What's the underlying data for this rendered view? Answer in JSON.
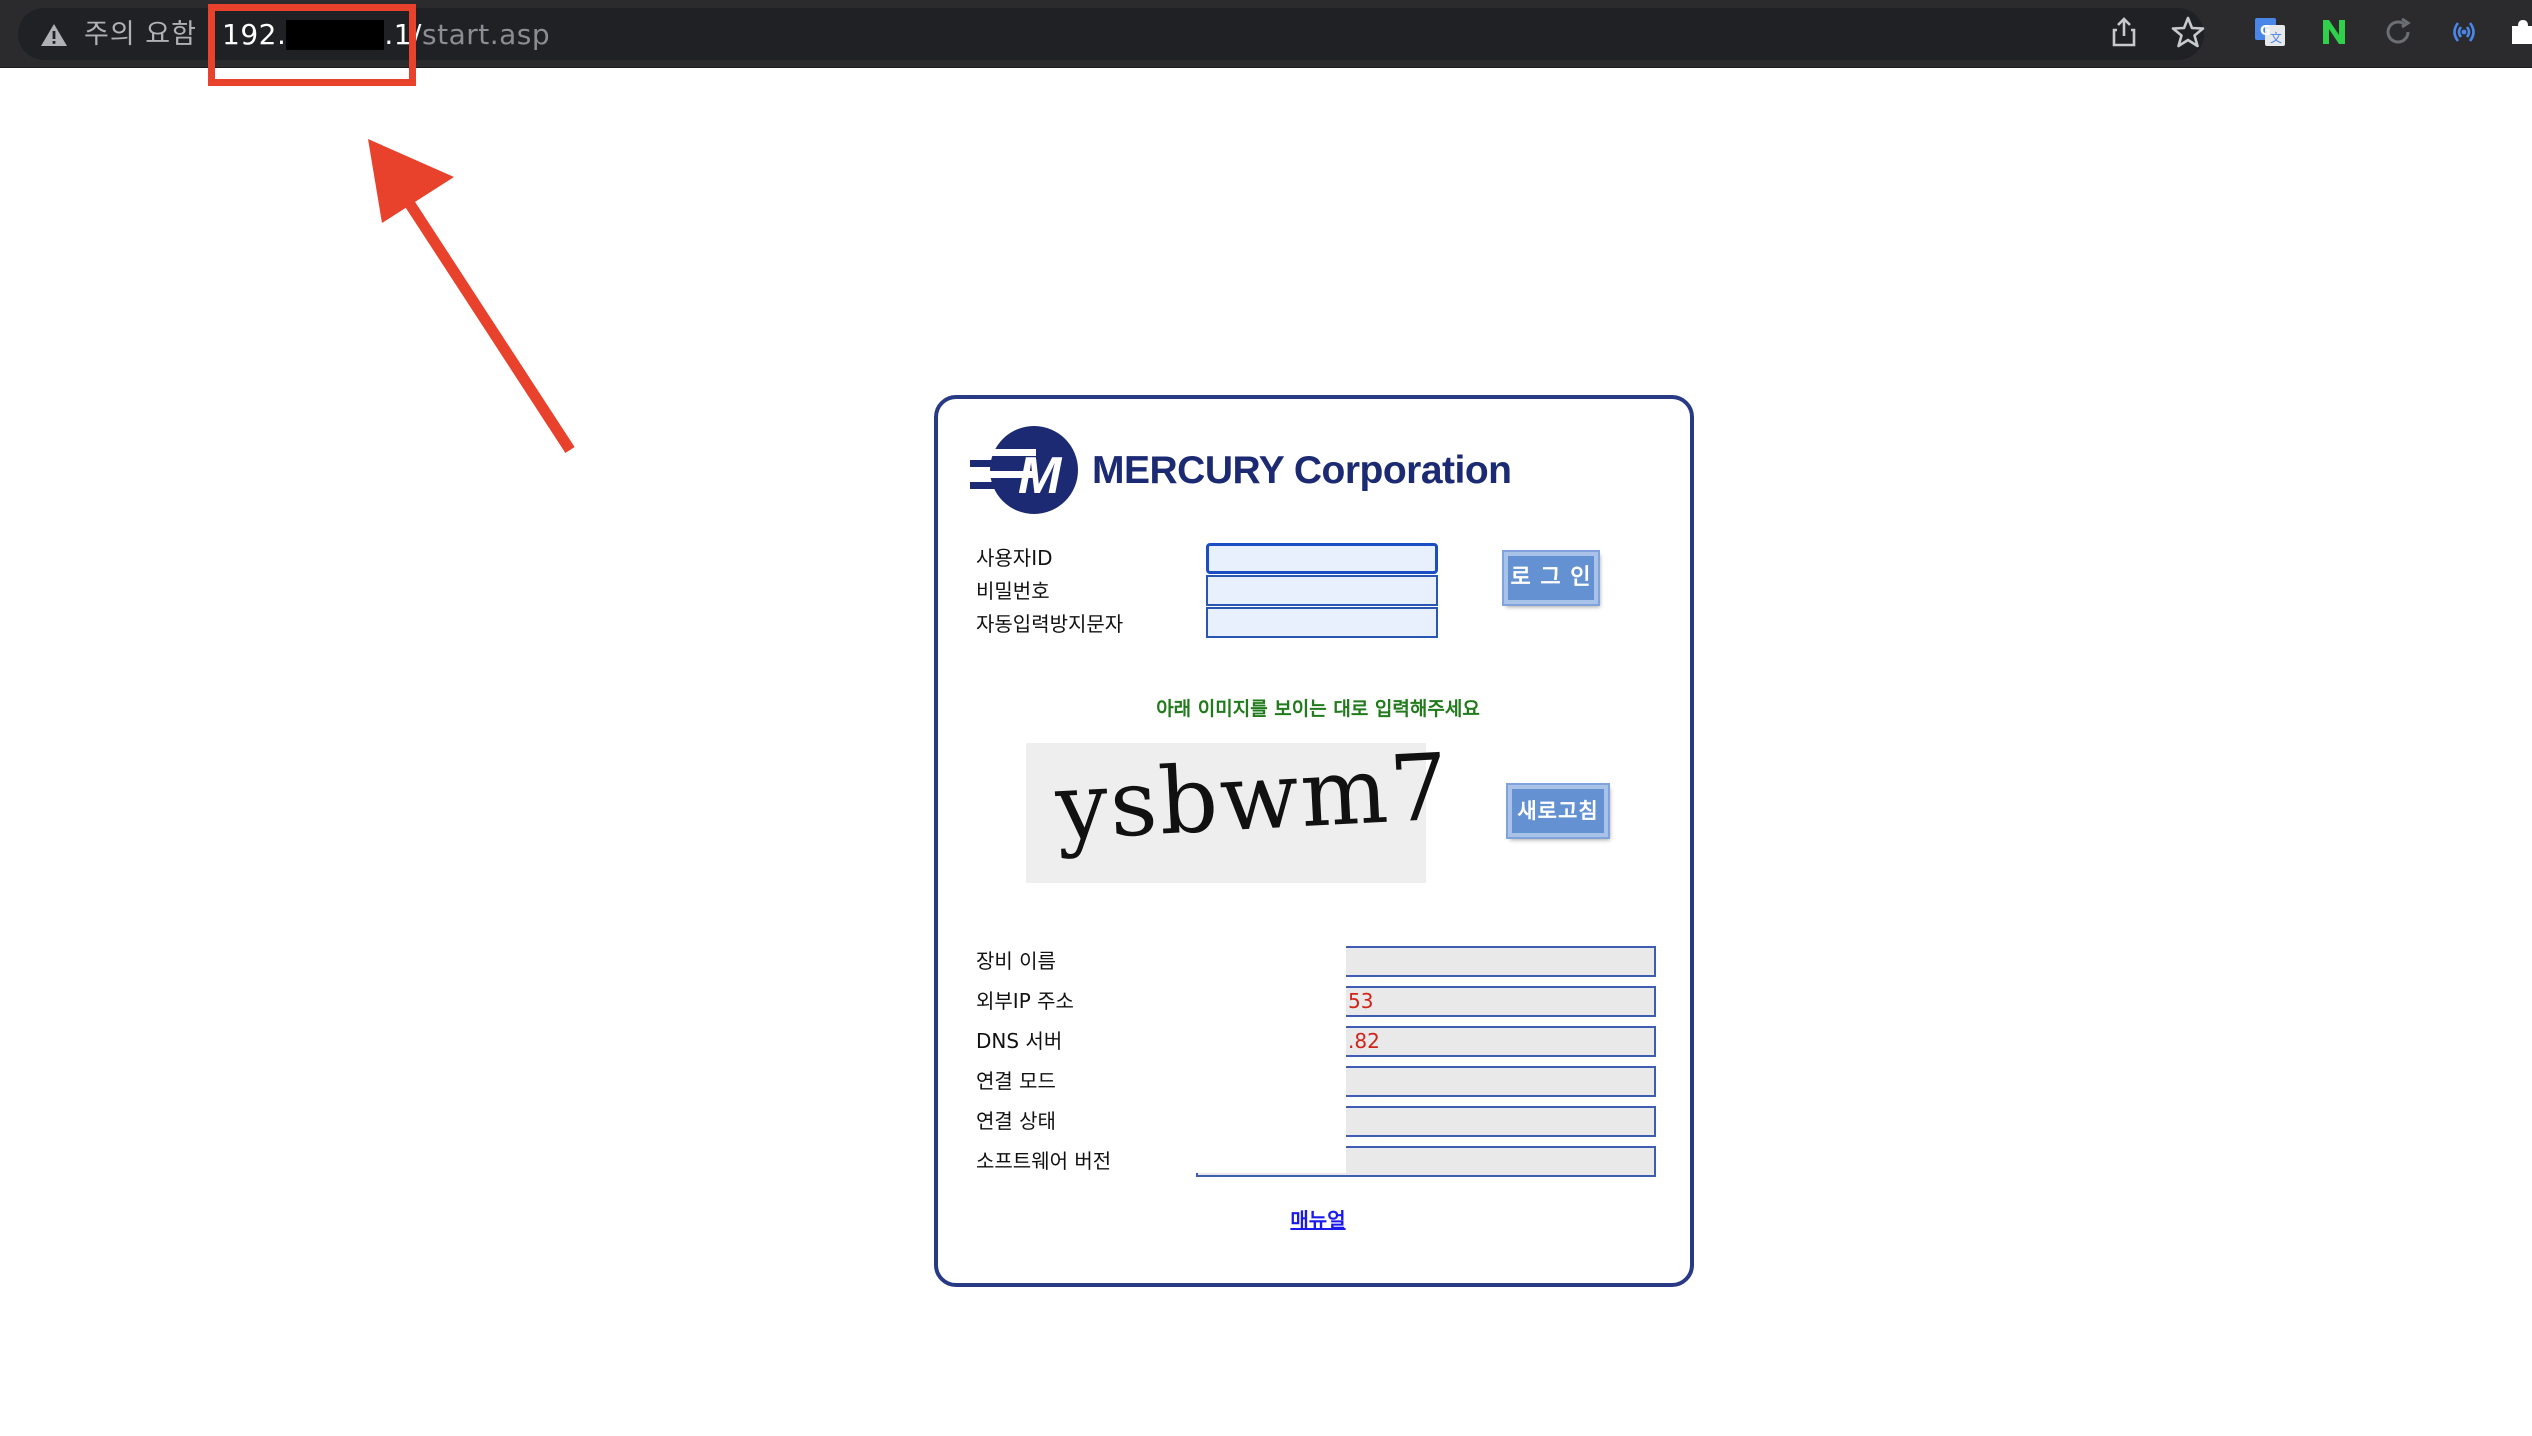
{
  "browser": {
    "security_label": "주의 요함",
    "url_host": "192.",
    "url_mid": ".1/",
    "url_path": "start.asp",
    "accent_color": "#e8412c",
    "toolbar_icons": [
      "share-icon",
      "bookmark-star-icon",
      "google-translate-icon",
      "naver-extension-icon",
      "reload-extension-icon",
      "broadcast-extension-icon",
      "extensions-puzzle-icon"
    ]
  },
  "panel": {
    "logo_text": "MERCURY Corporation",
    "fields": {
      "user_id_label": "사용자ID",
      "password_label": "비밀번호",
      "captcha_label": "자동입력방지문자"
    },
    "login_button": "로 그 인",
    "captcha_hint": "아래 이미지를 보이는 대로 입력해주세요",
    "captcha_text": "ysbwm7",
    "refresh_button": "새로고침",
    "device_info": [
      {
        "label": "장비 이름",
        "value": ""
      },
      {
        "label": "외부IP 주소",
        "value": "53"
      },
      {
        "label": "DNS 서버",
        "value": ".82"
      },
      {
        "label": "연결 모드",
        "value": ""
      },
      {
        "label": "연결 상태",
        "value": ""
      },
      {
        "label": "소프트웨어 버전",
        "value": ""
      }
    ],
    "manual_link": "매뉴얼",
    "border_color": "#283a85",
    "button_color": "#6491d1",
    "hint_color": "#217a1b",
    "value_color": "#d0241a"
  }
}
